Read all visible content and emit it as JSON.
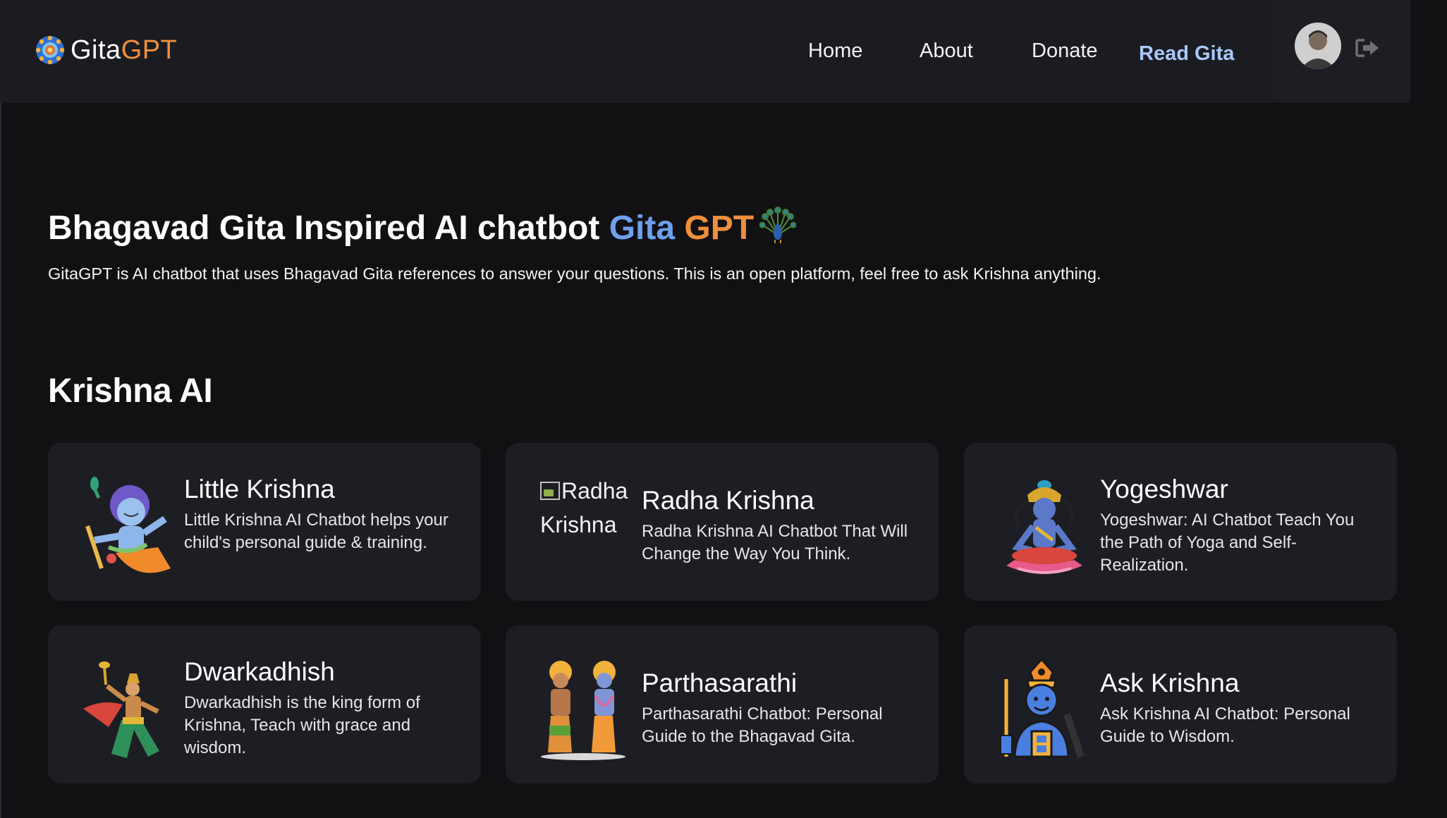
{
  "header": {
    "logo_text_part1": "Gita",
    "logo_text_part2": "GPT",
    "nav": {
      "home": "Home",
      "about": "About",
      "donate": "Donate",
      "read_gita": "Read Gita"
    },
    "icons": [
      "logo-mandala-icon",
      "avatar",
      "logout-icon"
    ]
  },
  "hero": {
    "title_main": "Bhagavad Gita Inspired AI chatbot ",
    "title_gita": "Gita",
    "title_gpt": "GPT",
    "subtitle": "GitaGPT is AI chatbot that uses Bhagavad Gita references to answer your questions. This is an open platform, feel free to ask Krishna anything."
  },
  "section": {
    "title": "Krishna AI"
  },
  "cards": [
    {
      "title": "Little Krishna",
      "description": "Little Krishna AI Chatbot helps your child's personal guide & training.",
      "icon": "little-krishna-icon"
    },
    {
      "title": "Radha Krishna",
      "description": "Radha Krishna AI Chatbot That Will Change the Way You Think.",
      "image_alt_line1": "Radha",
      "image_alt_line2": "Krishna"
    },
    {
      "title": "Yogeshwar",
      "description": "Yogeshwar: AI Chatbot Teach You the Path of Yoga and Self-Realization.",
      "icon": "yogeshwar-meditating-icon"
    },
    {
      "title": "Dwarkadhish",
      "description": "Dwarkadhish is the king form of Krishna, Teach with grace and wisdom.",
      "icon": "dwarkadhish-dancing-icon"
    },
    {
      "title": "Parthasarathi",
      "description": "Parthasarathi Chatbot: Personal Guide to the Bhagavad Gita.",
      "icon": "krishna-arjuna-icon"
    },
    {
      "title": "Ask Krishna",
      "description": "Ask Krishna AI Chatbot: Personal Guide to Wisdom.",
      "icon": "krishna-face-icon"
    }
  ],
  "colors": {
    "background": "#111113",
    "header": "#1a1c22",
    "card": "#1d1e23",
    "accent_blue": "#6ea0ec",
    "accent_orange": "#ef8e3c",
    "nav_active": "#a9c8f6"
  }
}
